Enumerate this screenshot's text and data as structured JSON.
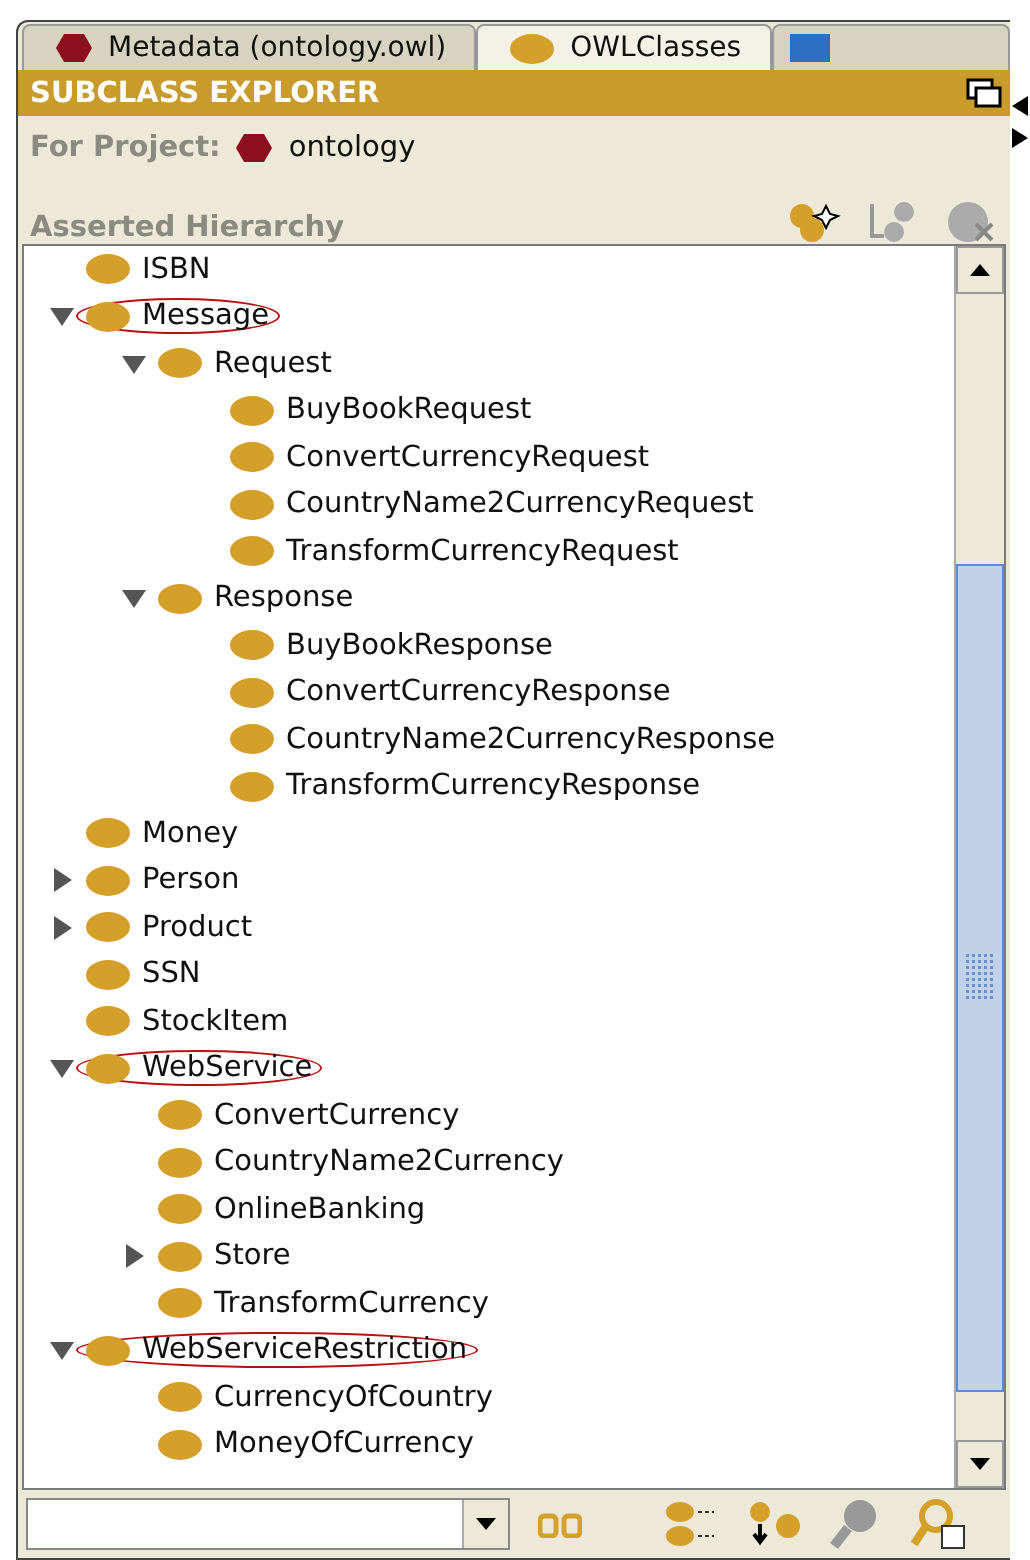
{
  "tabs": [
    {
      "label": "Metadata (ontology.owl)",
      "kind": "project",
      "selected": false
    },
    {
      "label": "OWLClasses",
      "kind": "class",
      "selected": true
    },
    {
      "kind": "blank",
      "selected": false
    }
  ],
  "panel": {
    "title": "SUBCLASS EXPLORER",
    "project_label": "For Project:",
    "project_name": "ontology",
    "hierarchy_label": "Asserted Hierarchy"
  },
  "tree": [
    {
      "label": "ISBN",
      "highlighted": false
    },
    {
      "label": "Message",
      "expanded": true,
      "highlighted": true,
      "children": [
        {
          "label": "Request",
          "expanded": true,
          "highlighted": false,
          "children": [
            {
              "label": "BuyBookRequest",
              "highlighted": false
            },
            {
              "label": "ConvertCurrencyRequest",
              "highlighted": false
            },
            {
              "label": "CountryName2CurrencyRequest",
              "highlighted": false
            },
            {
              "label": "TransformCurrencyRequest",
              "highlighted": false
            }
          ]
        },
        {
          "label": "Response",
          "expanded": true,
          "highlighted": false,
          "children": [
            {
              "label": "BuyBookResponse",
              "highlighted": false
            },
            {
              "label": "ConvertCurrencyResponse",
              "highlighted": false
            },
            {
              "label": "CountryName2CurrencyResponse",
              "highlighted": false
            },
            {
              "label": "TransformCurrencyResponse",
              "highlighted": false
            }
          ]
        }
      ]
    },
    {
      "label": "Money",
      "highlighted": false
    },
    {
      "label": "Person",
      "expanded": false,
      "highlighted": false
    },
    {
      "label": "Product",
      "expanded": false,
      "highlighted": false
    },
    {
      "label": "SSN",
      "highlighted": false
    },
    {
      "label": "StockItem",
      "highlighted": false
    },
    {
      "label": "WebService",
      "expanded": true,
      "highlighted": true,
      "children": [
        {
          "label": "ConvertCurrency",
          "highlighted": false
        },
        {
          "label": "CountryName2Currency",
          "highlighted": false
        },
        {
          "label": "OnlineBanking",
          "highlighted": false
        },
        {
          "label": "Store",
          "expanded": false,
          "highlighted": false
        },
        {
          "label": "TransformCurrency",
          "highlighted": false
        }
      ]
    },
    {
      "label": "WebServiceRestriction",
      "expanded": true,
      "highlighted": true,
      "children": [
        {
          "label": "CurrencyOfCountry",
          "highlighted": false
        },
        {
          "label": "MoneyOfCurrency",
          "highlighted": false
        }
      ]
    }
  ]
}
